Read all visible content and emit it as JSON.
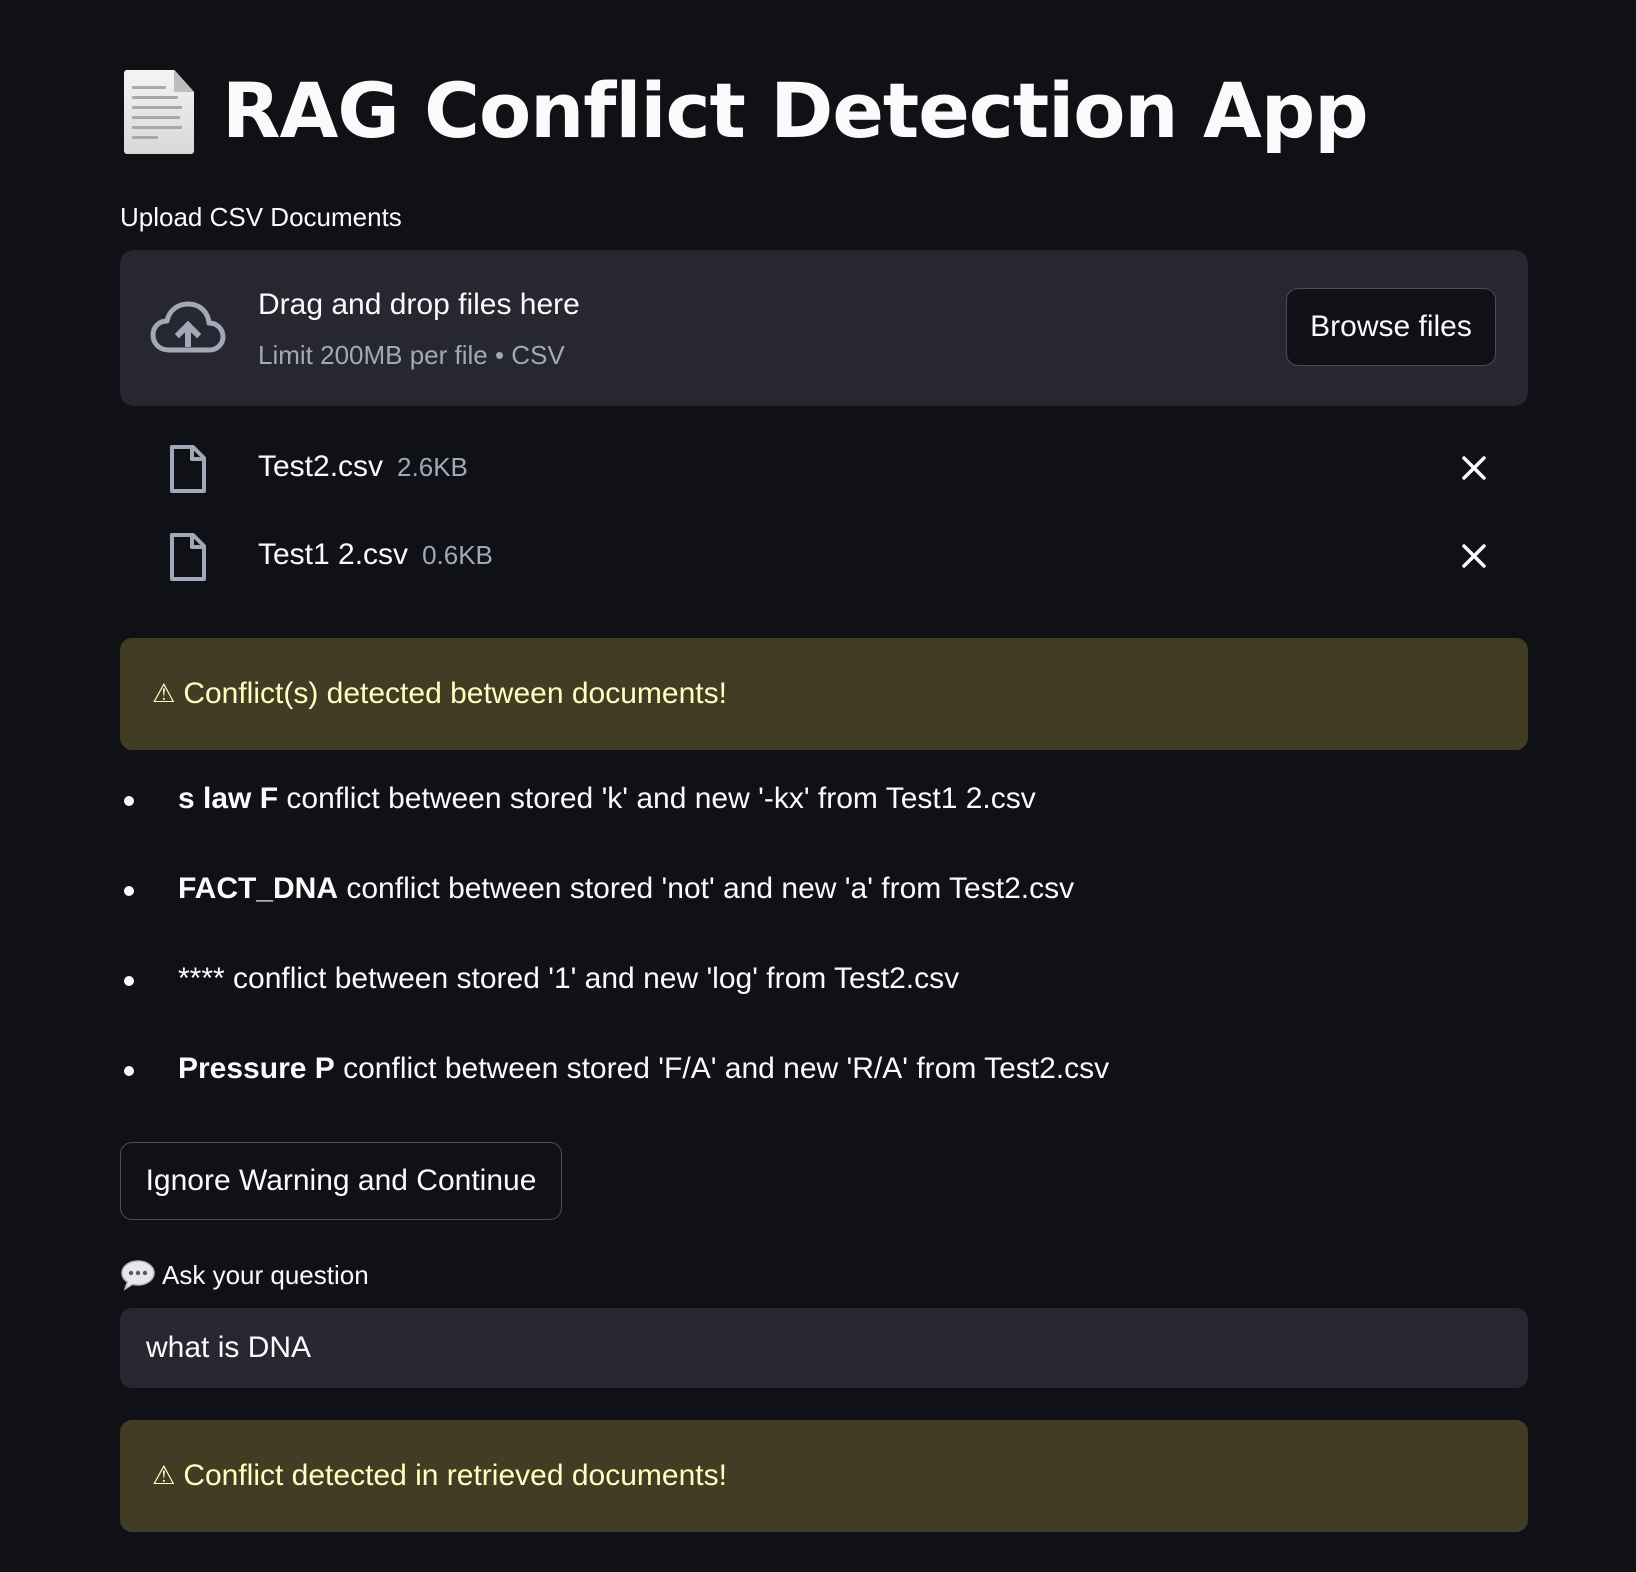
{
  "app": {
    "title": "RAG Conflict Detection App",
    "title_icon": "page-facing-up-icon"
  },
  "uploader": {
    "label": "Upload CSV Documents",
    "drop_title": "Drag and drop files here",
    "drop_subtitle": "Limit 200MB per file • CSV",
    "browse_label": "Browse files",
    "icon": "cloud-upload-icon"
  },
  "files": [
    {
      "name": "Test2.csv",
      "size": "2.6KB"
    },
    {
      "name": "Test1 2.csv",
      "size": "0.6KB"
    }
  ],
  "warnings": {
    "documents_conflict": "Conflict(s) detected between documents!",
    "retrieved_conflict": "Conflict detected in retrieved documents!",
    "icon": "⚠"
  },
  "conflicts": [
    {
      "key": "s law F",
      "text": "conflict between stored 'k' and new '-kx' from Test1 2.csv"
    },
    {
      "key": "FACT_DNA",
      "text": "conflict between stored 'not' and new 'a' from Test2.csv"
    },
    {
      "key": "",
      "text": "**** conflict between stored '1' and new 'log' from Test2.csv"
    },
    {
      "key": "Pressure P",
      "text": "conflict between stored 'F/A' and new 'R/A' from Test2.csv"
    }
  ],
  "actions": {
    "ignore_label": "Ignore Warning and Continue"
  },
  "question": {
    "label": "Ask your question",
    "icon": "speech-balloon-icon",
    "value": "what is DNA"
  },
  "colors": {
    "background": "#0f1117",
    "surface": "#262730",
    "warning_bg": "#413c24",
    "warning_text": "#ffffc2",
    "muted_text": "#a3a8b8"
  }
}
